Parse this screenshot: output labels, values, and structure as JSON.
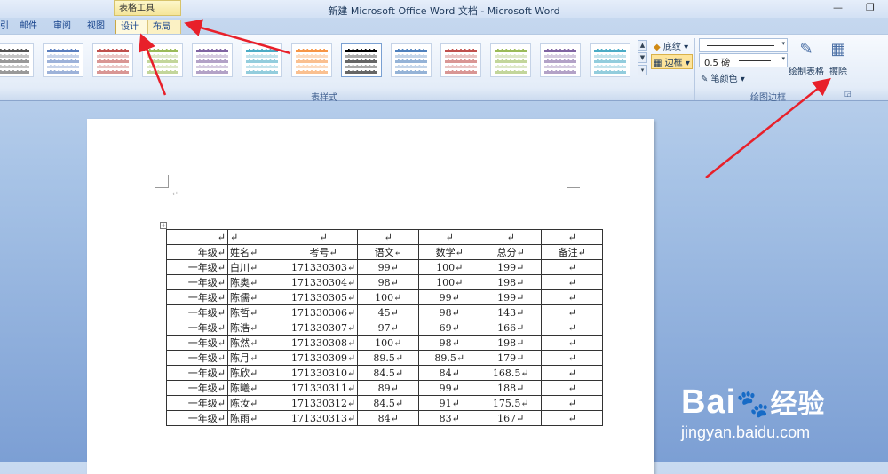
{
  "window": {
    "title": "新建 Microsoft Office Word 文档 - Microsoft Word",
    "restore_glyph": "❐",
    "minimize_glyph": "—"
  },
  "context": {
    "label": "表格工具"
  },
  "tabs": [
    {
      "label": "引"
    },
    {
      "label": "邮件"
    },
    {
      "label": "审阅"
    },
    {
      "label": "视图"
    },
    {
      "label": "设计"
    },
    {
      "label": "布局"
    }
  ],
  "ribbon": {
    "table_styles_label": "表样式",
    "shading_label": "底纹",
    "borders_label": "边框",
    "line_weight": "0.5 磅",
    "pen_color_label": "笔颜色",
    "draw_table_label": "绘制表格",
    "eraser_label": "擦除",
    "draw_borders_label": "绘图边框"
  },
  "colors": {
    "swatches": [
      "#555555",
      "#5b7fbf",
      "#c0504d",
      "#9bbb59",
      "#8064a2",
      "#4bacc6",
      "#f79646",
      "#000000",
      "#4f81bd",
      "#c0504d",
      "#9bbb59",
      "#8064a2",
      "#4bacc6"
    ],
    "arrow": "#e8202a"
  },
  "table": {
    "rows": [
      [
        "↵",
        "↵",
        "↵",
        "↵",
        "↵",
        "↵",
        "↵"
      ],
      [
        "年级↵",
        "姓名↵",
        "考号↵",
        "语文↵",
        "数学↵",
        "总分↵",
        "备注↵"
      ],
      [
        "一年级↵",
        "白川↵",
        "171330303↵",
        "99↵",
        "100↵",
        "199↵",
        "↵"
      ],
      [
        "一年级↵",
        "陈奥↵",
        "171330304↵",
        "98↵",
        "100↵",
        "198↵",
        "↵"
      ],
      [
        "一年级↵",
        "陈儒↵",
        "171330305↵",
        "100↵",
        "99↵",
        "199↵",
        "↵"
      ],
      [
        "一年级↵",
        "陈哲↵",
        "171330306↵",
        "45↵",
        "98↵",
        "143↵",
        "↵"
      ],
      [
        "一年级↵",
        "陈浩↵",
        "171330307↵",
        "97↵",
        "69↵",
        "166↵",
        "↵"
      ],
      [
        "一年级↵",
        "陈然↵",
        "171330308↵",
        "100↵",
        "98↵",
        "198↵",
        "↵"
      ],
      [
        "一年级↵",
        "陈月↵",
        "171330309↵",
        "89.5↵",
        "89.5↵",
        "179↵",
        "↵"
      ],
      [
        "一年级↵",
        "陈欣↵",
        "171330310↵",
        "84.5↵",
        "84↵",
        "168.5↵",
        "↵"
      ],
      [
        "一年级↵",
        "陈曦↵",
        "171330311↵",
        "89↵",
        "99↵",
        "188↵",
        "↵"
      ],
      [
        "一年级↵",
        "陈汝↵",
        "171330312↵",
        "84.5↵",
        "91↵",
        "175.5↵",
        "↵"
      ],
      [
        "一年级↵",
        "陈雨↵",
        "171330313↵",
        "84↵",
        "83↵",
        "167↵",
        "↵"
      ]
    ]
  },
  "watermark": {
    "brand_a": "Bai",
    "brand_b": "经验",
    "url": "jingyan.baidu.com"
  }
}
